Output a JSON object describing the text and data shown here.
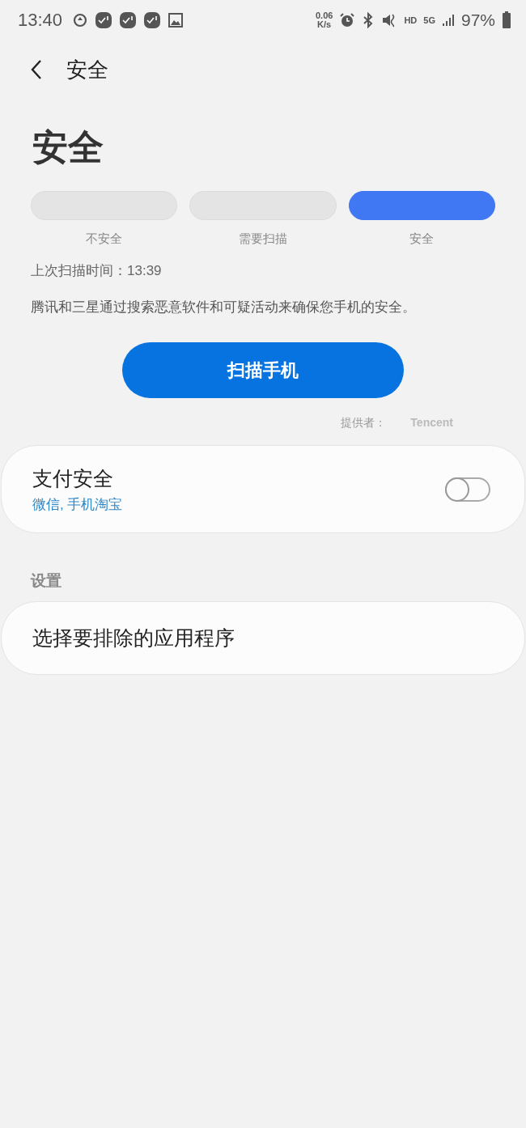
{
  "status_bar": {
    "time": "13:40",
    "net_speed": "0.06",
    "net_unit": "K/s",
    "hd": "HD",
    "network": "5G",
    "battery": "97%"
  },
  "header": {
    "title": "安全"
  },
  "page_title": "安全",
  "levels": [
    {
      "label": "不安全",
      "selected": false
    },
    {
      "label": "需要扫描",
      "selected": false
    },
    {
      "label": "安全",
      "selected": true
    }
  ],
  "last_scan": "上次扫描时间：13:39",
  "description": "腾讯和三星通过搜索恶意软件和可疑活动来确保您手机的安全。",
  "scan_button": "扫描手机",
  "provider": {
    "label": "提供者：",
    "name": "Tencent"
  },
  "payment": {
    "title": "支付安全",
    "subtitle": "微信, 手机淘宝",
    "on": false
  },
  "settings": {
    "header": "设置",
    "items": [
      "选择要排除的应用程序"
    ]
  }
}
